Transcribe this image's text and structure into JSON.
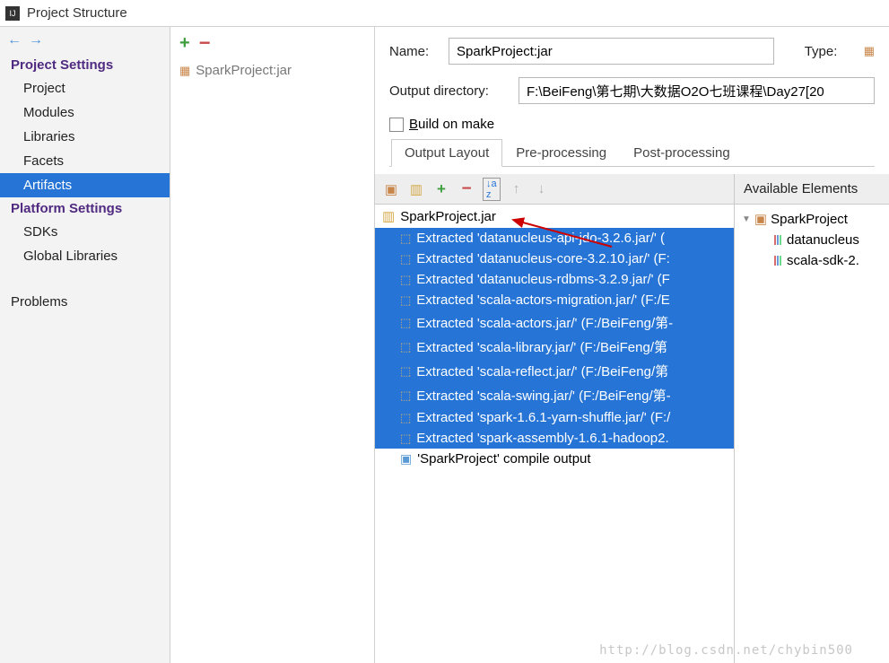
{
  "titlebar": {
    "icon": "IJ",
    "text": "Project Structure"
  },
  "sidebar": {
    "sections": [
      {
        "title": "Project Settings",
        "items": [
          "Project",
          "Modules",
          "Libraries",
          "Facets",
          "Artifacts"
        ]
      },
      {
        "title": "Platform Settings",
        "items": [
          "SDKs",
          "Global Libraries"
        ]
      }
    ],
    "problems": "Problems",
    "selected": "Artifacts"
  },
  "middle": {
    "item": "SparkProject:jar"
  },
  "form": {
    "name_label": "Name:",
    "name_value": "SparkProject:jar",
    "type_label": "Type:",
    "output_dir_label": "Output directory:",
    "output_dir_value": "F:\\BeiFeng\\第七期\\大数据O2O七班课程\\Day27[20",
    "build_on_make": "Build on make"
  },
  "tabs": [
    "Output Layout",
    "Pre-processing",
    "Post-processing"
  ],
  "output": {
    "root": "SparkProject.jar",
    "items": [
      "Extracted 'datanucleus-api-jdo-3.2.6.jar/' (",
      "Extracted 'datanucleus-core-3.2.10.jar/' (F:",
      "Extracted 'datanucleus-rdbms-3.2.9.jar/' (F",
      "Extracted 'scala-actors-migration.jar/' (F:/E",
      "Extracted 'scala-actors.jar/' (F:/BeiFeng/第-",
      "Extracted 'scala-library.jar/' (F:/BeiFeng/第",
      "Extracted 'scala-reflect.jar/' (F:/BeiFeng/第",
      "Extracted 'scala-swing.jar/' (F:/BeiFeng/第-",
      "Extracted 'spark-1.6.1-yarn-shuffle.jar/' (F:/",
      "Extracted 'spark-assembly-1.6.1-hadoop2."
    ],
    "compile": "'SparkProject' compile output"
  },
  "available": {
    "header": "Available Elements",
    "root": "SparkProject",
    "items": [
      "datanucleus",
      "scala-sdk-2."
    ]
  },
  "watermark": "http://blog.csdn.net/chybin500"
}
